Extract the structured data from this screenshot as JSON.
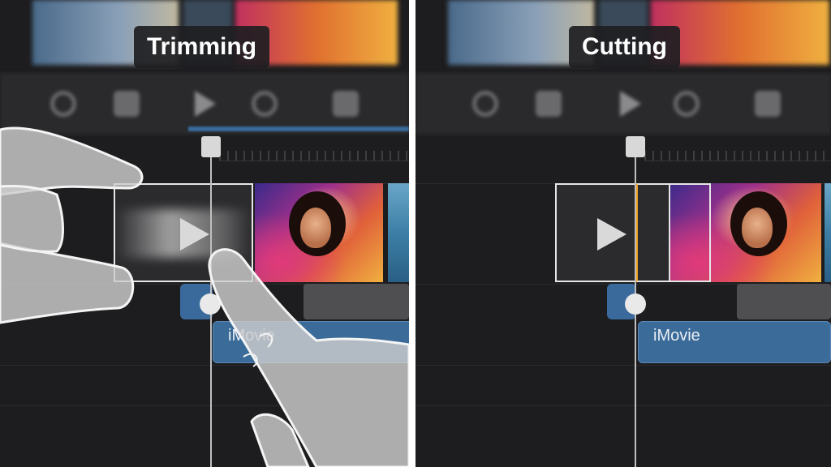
{
  "left_panel": {
    "label": "Trimming",
    "title_clip_text": "iMovie"
  },
  "right_panel": {
    "label": "Cutting",
    "title_clip_text": "iMovie"
  },
  "colors": {
    "title_clip": "#3b6b99",
    "cut_marker": "#f0a020",
    "divider": "#ffffff"
  },
  "icons": {
    "preview_play": "play-icon",
    "hand_illustration": "hand-icon"
  }
}
